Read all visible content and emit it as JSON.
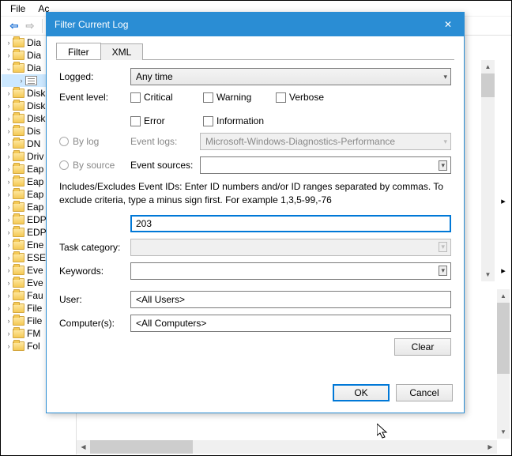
{
  "menu": {
    "file": "File",
    "action": "Ac"
  },
  "tree_items": [
    {
      "type": "folder",
      "expander": "",
      "label": "Dia"
    },
    {
      "type": "folder",
      "expander": "",
      "label": "Dia"
    },
    {
      "type": "folder",
      "expander": "v",
      "label": "Dia"
    },
    {
      "type": "log",
      "expander": "",
      "label": "",
      "selected": true,
      "indent": true
    },
    {
      "type": "folder",
      "expander": "",
      "label": "Disk"
    },
    {
      "type": "folder",
      "expander": "",
      "label": "Disk"
    },
    {
      "type": "folder",
      "expander": "",
      "label": "Disk"
    },
    {
      "type": "folder",
      "expander": "",
      "label": "Dis"
    },
    {
      "type": "folder",
      "expander": "",
      "label": "DN"
    },
    {
      "type": "folder",
      "expander": "",
      "label": "Driv"
    },
    {
      "type": "folder",
      "expander": "",
      "label": "Eap"
    },
    {
      "type": "folder",
      "expander": "",
      "label": "Eap"
    },
    {
      "type": "folder",
      "expander": "",
      "label": "Eap"
    },
    {
      "type": "folder",
      "expander": "",
      "label": "Eap"
    },
    {
      "type": "folder",
      "expander": "",
      "label": "EDP"
    },
    {
      "type": "folder",
      "expander": "",
      "label": "EDP"
    },
    {
      "type": "folder",
      "expander": "",
      "label": "Ene"
    },
    {
      "type": "folder",
      "expander": "",
      "label": "ESE"
    },
    {
      "type": "folder",
      "expander": "",
      "label": "Eve"
    },
    {
      "type": "folder",
      "expander": "",
      "label": "Eve"
    },
    {
      "type": "folder",
      "expander": "",
      "label": "Fau"
    },
    {
      "type": "folder",
      "expander": "",
      "label": "File"
    },
    {
      "type": "folder",
      "expander": "",
      "label": "File"
    },
    {
      "type": "folder",
      "expander": "",
      "label": "FM"
    },
    {
      "type": "folder",
      "expander": "",
      "label": "Fol"
    }
  ],
  "dialog": {
    "title": "Filter Current Log",
    "tabs": {
      "filter": "Filter",
      "xml": "XML"
    },
    "labels": {
      "logged": "Logged:",
      "event_level": "Event level:",
      "by_log": "By log",
      "by_source": "By source",
      "event_logs": "Event logs:",
      "event_sources": "Event sources:",
      "includes_desc": "Includes/Excludes Event IDs: Enter ID numbers and/or ID ranges separated by commas. To exclude criteria, type a minus sign first. For example 1,3,5-99,-76",
      "task_category": "Task category:",
      "keywords": "Keywords:",
      "user": "User:",
      "computers": "Computer(s):"
    },
    "values": {
      "logged": "Any time",
      "event_logs": "Microsoft-Windows-Diagnostics-Performance",
      "event_sources": "",
      "event_id": "203",
      "task_category": "",
      "keywords": "",
      "user": "<All Users>",
      "computers": "<All Computers>"
    },
    "checkboxes": {
      "critical": "Critical",
      "warning": "Warning",
      "verbose": "Verbose",
      "error": "Error",
      "information": "Information"
    },
    "buttons": {
      "clear": "Clear",
      "ok": "OK",
      "cancel": "Cancel"
    }
  }
}
